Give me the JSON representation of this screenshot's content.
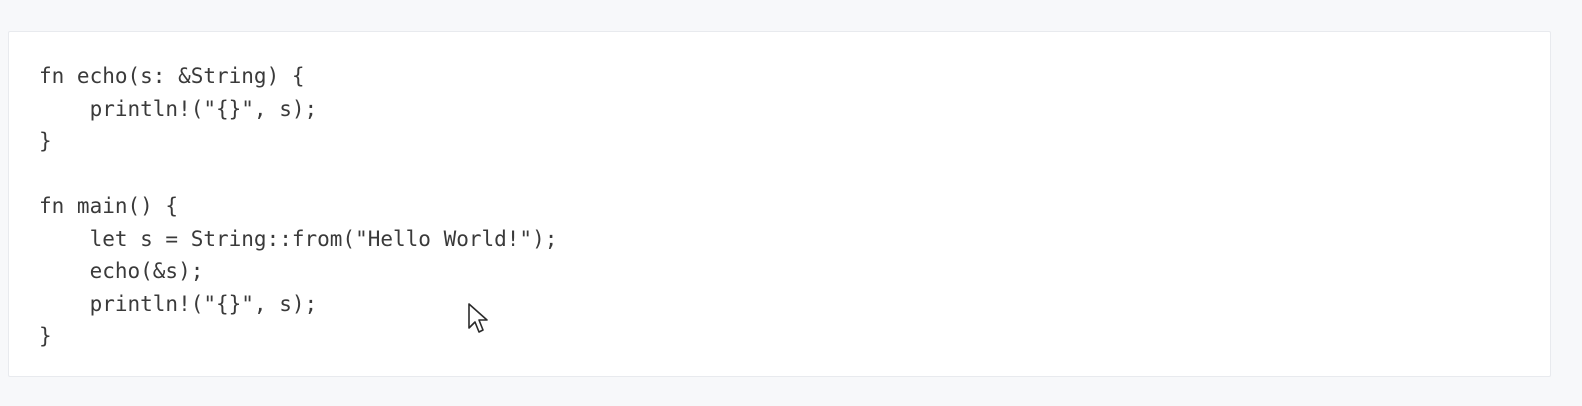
{
  "code": {
    "lines": [
      "fn echo(s: &String) {",
      "    println!(\"{}\", s);",
      "}",
      "",
      "fn main() {",
      "    let s = String::from(\"Hello World!\");",
      "    echo(&s);",
      "    println!(\"{}\", s);",
      "}"
    ]
  },
  "cursor": {
    "icon": "mouse-pointer-icon"
  },
  "colors": {
    "page_background": "#f7f8fa",
    "block_background": "#ffffff",
    "text": "#3a3a3a"
  }
}
